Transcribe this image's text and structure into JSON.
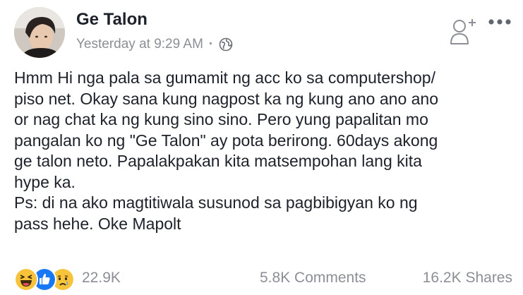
{
  "post": {
    "author": "Ge Talon",
    "timestamp": "Yesterday at 9:29 AM",
    "separator": "·",
    "privacy_icon": "globe-icon",
    "text_lines": [
      "Hmm Hi nga pala sa gumamit ng acc ko sa computershop/",
      "piso net. Okay sana kung nagpost ka ng kung ano ano ano",
      "or nag chat ka ng kung sino sino. Pero yung papalitan mo",
      "pangalan ko ng \"Ge Talon\" ay pota berirong. 60days akong",
      "ge talon neto. Papalakpakan kita matsempohan lang kita",
      "hype ka.",
      "Ps: di na ako magtitiwala susunod sa pagbibigyan ko ng",
      "pass hehe. Oke Mapolt"
    ]
  },
  "reactions": {
    "icons": [
      "haha-icon",
      "like-icon",
      "sad-icon"
    ],
    "count": "22.9K"
  },
  "stats": {
    "comments": "5.8K Comments",
    "shares": "16.2K Shares"
  },
  "colors": {
    "text": "#1d2129",
    "secondary": "#8c8f95",
    "like_blue": "#1877f2",
    "emoji_yellow": "#f7c33b"
  }
}
